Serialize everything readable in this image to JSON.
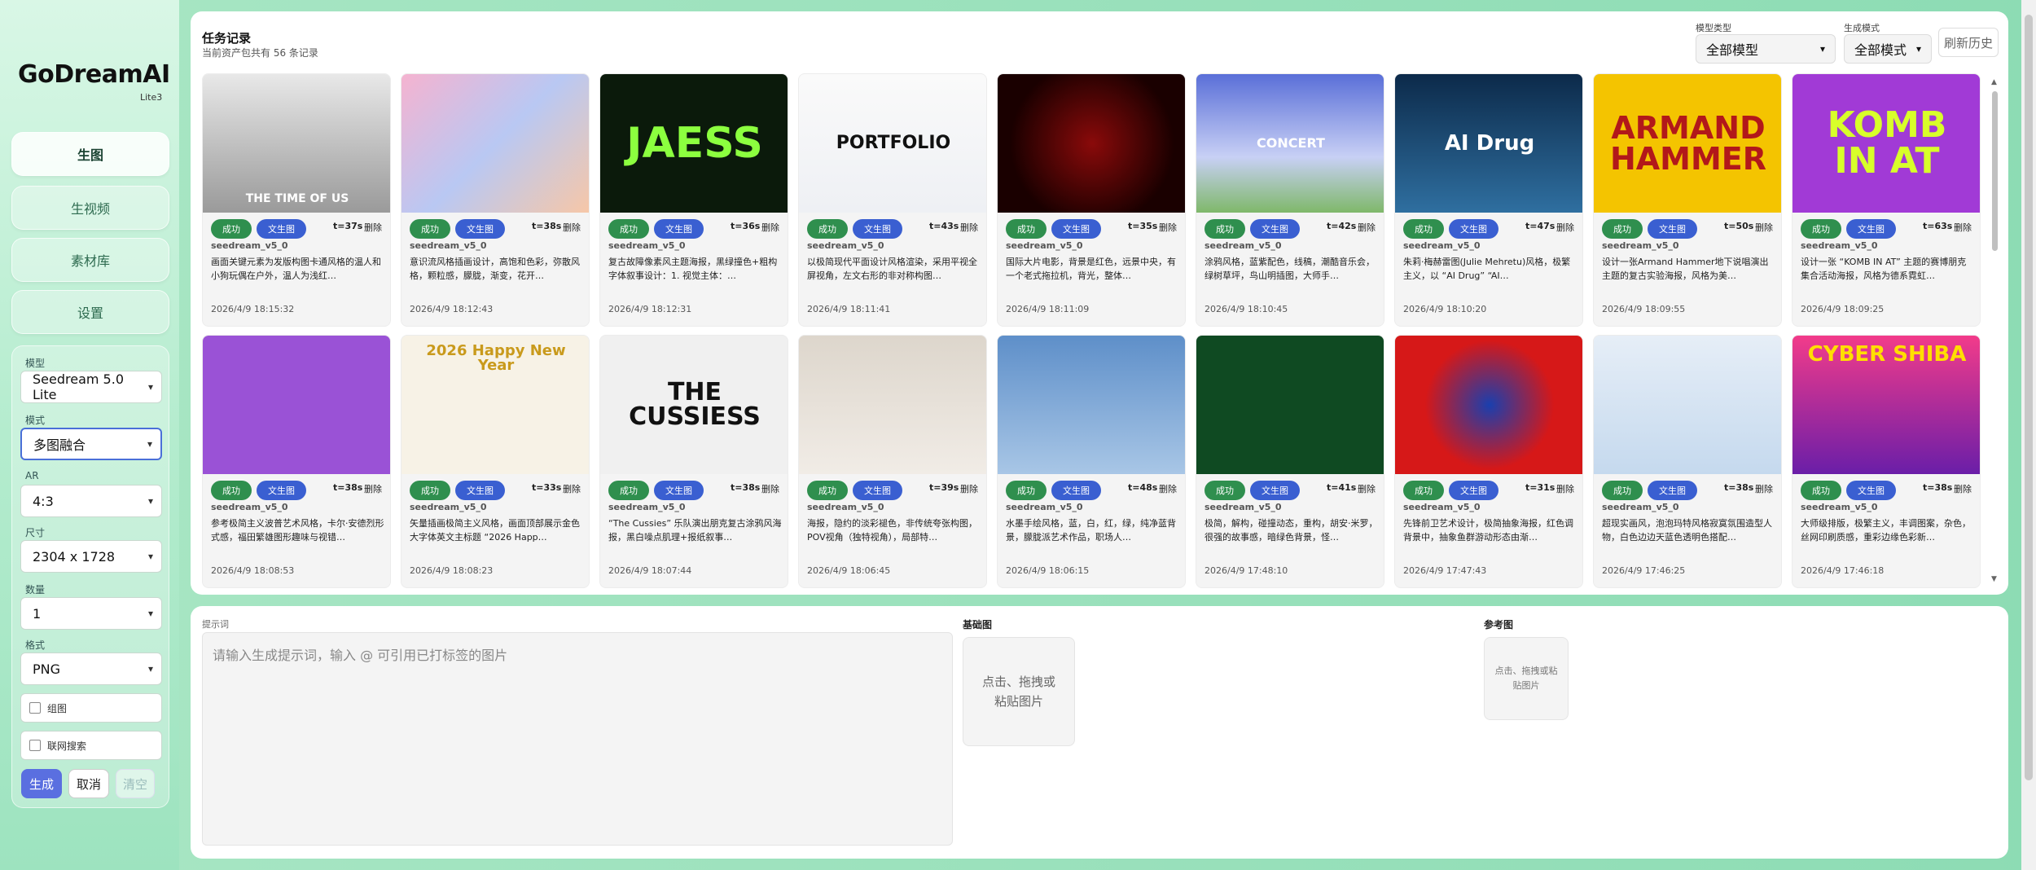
{
  "app": {
    "logo": "GoDreamAI",
    "version": "Lite3"
  },
  "nav": [
    {
      "label": "生图",
      "active": true
    },
    {
      "label": "生视频",
      "active": false
    },
    {
      "label": "素材库",
      "active": false
    },
    {
      "label": "设置",
      "active": false
    }
  ],
  "form": {
    "model_label": "模型",
    "model_value": "Seedream 5.0 Lite",
    "mode_label": "模式",
    "mode_value": "多图融合",
    "ar_label": "AR",
    "ar_value": "4:3",
    "size_label": "尺寸",
    "size_value": "2304 x 1728",
    "count_label": "数量",
    "count_value": "1",
    "format_label": "格式",
    "format_value": "PNG",
    "group_label": "组图",
    "search_label": "联网搜索",
    "generate": "生成",
    "cancel": "取消",
    "clear": "清空"
  },
  "tasks": {
    "title": "任务记录",
    "subtitle": "当前资产包共有 56 条记录",
    "model_type_label": "模型类型",
    "model_type_value": "全部模型",
    "gen_mode_label": "生成模式",
    "gen_mode_value": "全部模式",
    "refresh": "刷新历史",
    "status_label": "成功",
    "type_label": "文生图",
    "delete_label": "删除",
    "cards": [
      {
        "time": "t=37s",
        "model": "seedream_v5_0",
        "desc": "画面关键元素为发版构图卡通风格的温人和小狗玩偶在户外，温人为浅红…",
        "date": "2026/4/9 18:15:32",
        "thumb_text": "THE TIME OF US"
      },
      {
        "time": "t=38s",
        "model": "seedream_v5_0",
        "desc": "意识流风格插画设计，高饱和色彩，弥散风格，颗粒感，朦胧，渐变，花开…",
        "date": "2026/4/9 18:12:43",
        "thumb_text": ""
      },
      {
        "time": "t=36s",
        "model": "seedream_v5_0",
        "desc": "复古故障像素风主题海报，黑绿撞色+粗构字体叙事设计：1. 视觉主体：…",
        "date": "2026/4/9 18:12:31",
        "thumb_text": "JAESS"
      },
      {
        "time": "t=43s",
        "model": "seedream_v5_0",
        "desc": "以极简现代平面设计风格渲染，采用平视全屏视角，左文右形的非对称构图…",
        "date": "2026/4/9 18:11:41",
        "thumb_text": "PORTFOLIO"
      },
      {
        "time": "t=35s",
        "model": "seedream_v5_0",
        "desc": "国际大片电影，背景是红色，远景中央，有一个老式拖拉机，背光，整体…",
        "date": "2026/4/9 18:11:09",
        "thumb_text": ""
      },
      {
        "time": "t=42s",
        "model": "seedream_v5_0",
        "desc": "涂鸦风格，蓝紫配色，线稿，潮酷音乐会，绿树草坪，鸟山明插图，大师手…",
        "date": "2026/4/9 18:10:45",
        "thumb_text": "CONCERT"
      },
      {
        "time": "t=47s",
        "model": "seedream_v5_0",
        "desc": "朱莉·梅赫雷图(Julie Mehretu)风格，极繁主义，以 “AI Drug” “AI…",
        "date": "2026/4/9 18:10:20",
        "thumb_text": "AI Drug"
      },
      {
        "time": "t=50s",
        "model": "seedream_v5_0",
        "desc": "设计一张Armand Hammer地下说唱演出主题的复古实验海报，风格为美…",
        "date": "2026/4/9 18:09:55",
        "thumb_text": "ARMAND HAMMER"
      },
      {
        "time": "t=63s",
        "model": "seedream_v5_0",
        "desc": "设计一张 “KOMB IN AT” 主题的赛博朋克集合活动海报，风格为德系霓虹…",
        "date": "2026/4/9 18:09:25",
        "thumb_text": "KOMB IN AT"
      },
      {
        "time": "t=38s",
        "model": "seedream_v5_0",
        "desc": "参考极简主义波普艺术风格，卡尔·安德烈形式感，福田繁雄图形趣味与视错…",
        "date": "2026/4/9 18:08:53",
        "thumb_text": ""
      },
      {
        "time": "t=33s",
        "model": "seedream_v5_0",
        "desc": "矢量插画极简主义风格，画面顶部展示金色大字体英文主标题 “2026 Happ…",
        "date": "2026/4/9 18:08:23",
        "thumb_text": "2026 Happy New Year"
      },
      {
        "time": "t=38s",
        "model": "seedream_v5_0",
        "desc": "“The Cussies” 乐队演出朋克复古涂鸦风海报，黑白噪点肌理+报纸叙事…",
        "date": "2026/4/9 18:07:44",
        "thumb_text": "THE CUSSIESS"
      },
      {
        "time": "t=39s",
        "model": "seedream_v5_0",
        "desc": "海报，隐约的淡彩褪色，非传统夸张构图，POV视角（独特视角），局部特…",
        "date": "2026/4/9 18:06:45",
        "thumb_text": ""
      },
      {
        "time": "t=48s",
        "model": "seedream_v5_0",
        "desc": "水墨手绘风格，蓝，白，红，绿，纯净蓝背景，朦胧派艺术作品，职场人…",
        "date": "2026/4/9 18:06:15",
        "thumb_text": ""
      },
      {
        "time": "t=41s",
        "model": "seedream_v5_0",
        "desc": "极简，解构，碰撞动态，重构，胡安·米罗，很强的故事感，暗绿色背景，怪…",
        "date": "2026/4/9 17:48:10",
        "thumb_text": ""
      },
      {
        "time": "t=31s",
        "model": "seedream_v5_0",
        "desc": "先锋前卫艺术设计，极简抽象海报，红色调背景中，抽象鱼群游动形态由渐…",
        "date": "2026/4/9 17:47:43",
        "thumb_text": ""
      },
      {
        "time": "t=38s",
        "model": "seedream_v5_0",
        "desc": "超现实画风，泡泡玛特风格寂寞氛围造型人物，白色边边天蓝色透明色搭配…",
        "date": "2026/4/9 17:46:25",
        "thumb_text": ""
      },
      {
        "time": "t=38s",
        "model": "seedream_v5_0",
        "desc": "大师级排版，极繁主义，丰调图案，杂色，丝网印刷质感，重彩边缘色彩新…",
        "date": "2026/4/9 17:46:18",
        "thumb_text": "CYBER SHIBA"
      }
    ]
  },
  "bottom": {
    "prompt_label": "提示词",
    "prompt_placeholder": "请输入生成提示词，输入 @ 可引用已打标签的图片",
    "base_label": "基础图",
    "base_drop": "点击、拖拽或粘贴图片",
    "ref_label": "参考图",
    "ref_drop": "点击、拖拽或粘贴图片"
  }
}
